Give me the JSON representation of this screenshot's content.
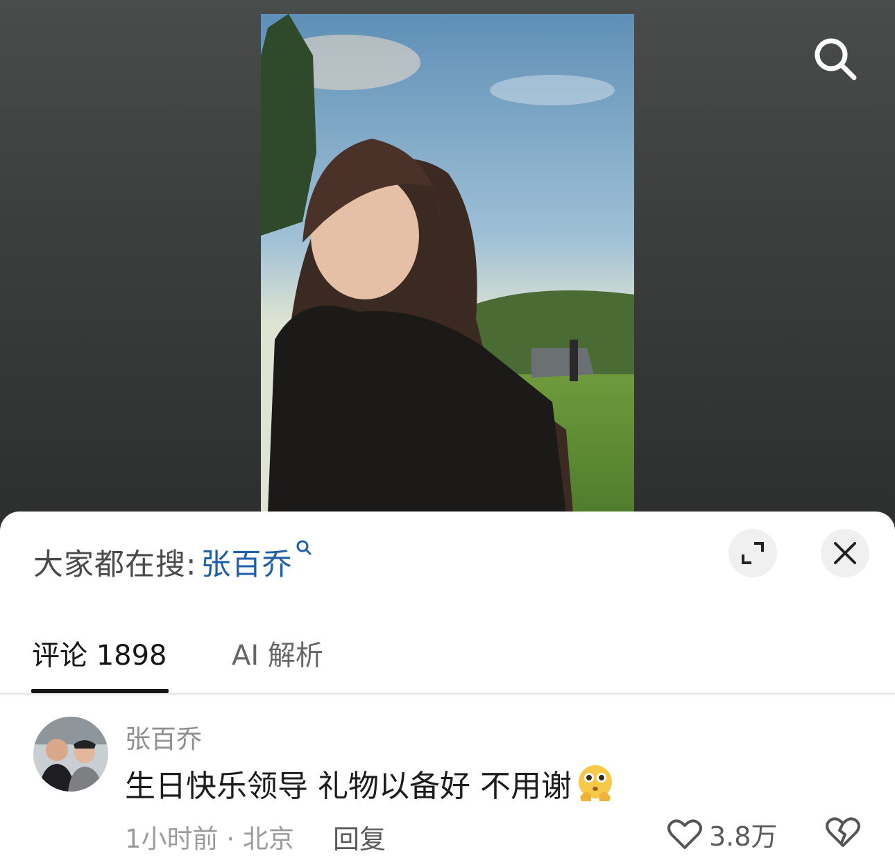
{
  "search_suggestion": {
    "prefix": "大家都在搜:",
    "keyword": "张百乔"
  },
  "tabs": [
    {
      "label": "评论 1898",
      "active": true
    },
    {
      "label": "AI 解析",
      "active": false
    }
  ],
  "comment": {
    "username": "张百乔",
    "text": "生日快乐领导 礼物以备好 不用谢",
    "meta": "1小时前 · 北京",
    "reply_label": "回复",
    "like_count": "3.8万"
  },
  "icons": {
    "search": "search-icon",
    "expand": "expand-icon",
    "close": "close-icon",
    "like": "heart-icon",
    "dislike": "broken-heart-icon",
    "emoji": "pleading-emoji-icon"
  },
  "colors": {
    "link": "#1f5fa8",
    "text": "#1c1c1c",
    "muted": "#9b9b9b"
  }
}
